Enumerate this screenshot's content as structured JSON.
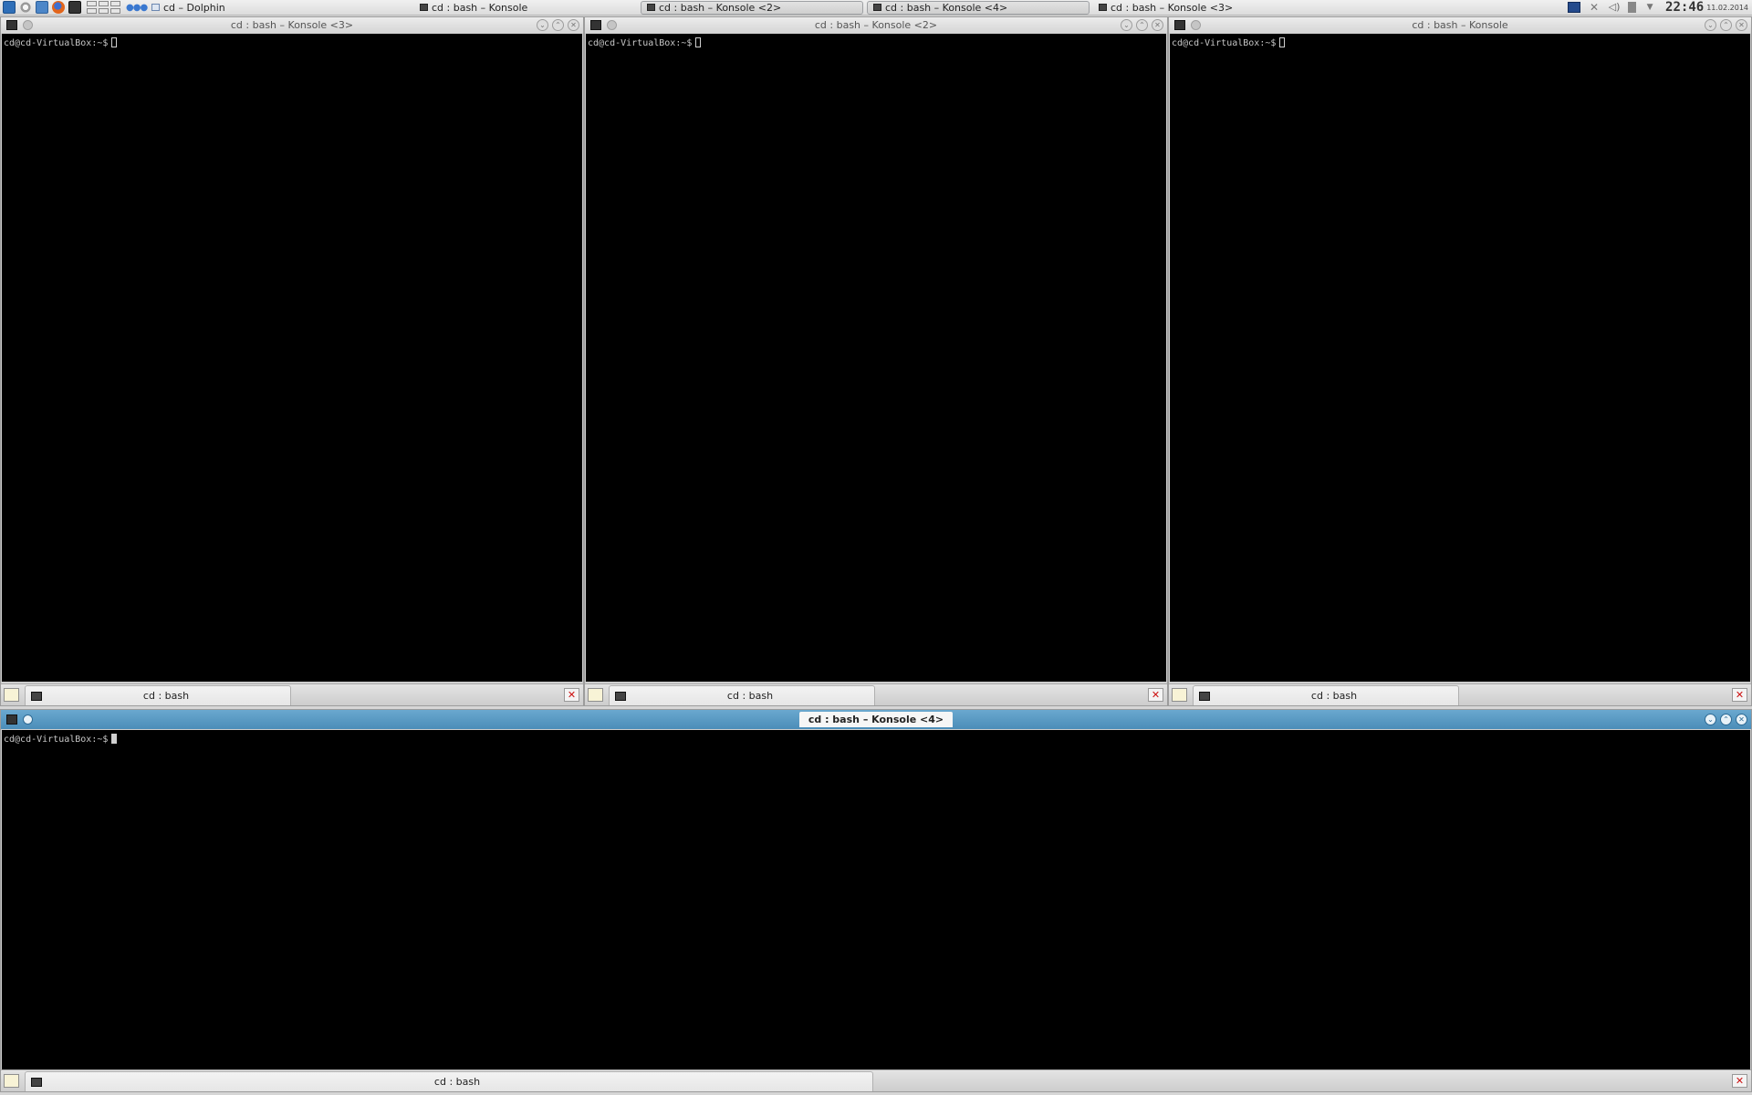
{
  "taskbar": {
    "tasks": [
      {
        "label": "cd – Dolphin"
      },
      {
        "label": "cd : bash – Konsole"
      },
      {
        "label": "cd : bash – Konsole <2>"
      },
      {
        "label": "cd : bash – Konsole <4>"
      },
      {
        "label": "cd : bash – Konsole <3>"
      }
    ],
    "clock": "22:46",
    "date": "11.02.2014"
  },
  "windows": [
    {
      "title": "cd : bash – Konsole <3>",
      "prompt": "cd@cd-VirtualBox:~$",
      "tab_label": "cd : bash"
    },
    {
      "title": "cd : bash – Konsole <2>",
      "prompt": "cd@cd-VirtualBox:~$",
      "tab_label": "cd : bash"
    },
    {
      "title": "cd : bash – Konsole",
      "prompt": "cd@cd-VirtualBox:~$",
      "tab_label": "cd : bash"
    },
    {
      "title": "cd : bash – Konsole <4>",
      "prompt": "cd@cd-VirtualBox:~$",
      "tab_label": "cd : bash"
    }
  ],
  "colors": {
    "focused_titlebar": "#4b8db8",
    "terminal_bg": "#000000",
    "terminal_fg": "#c8c8c8"
  }
}
